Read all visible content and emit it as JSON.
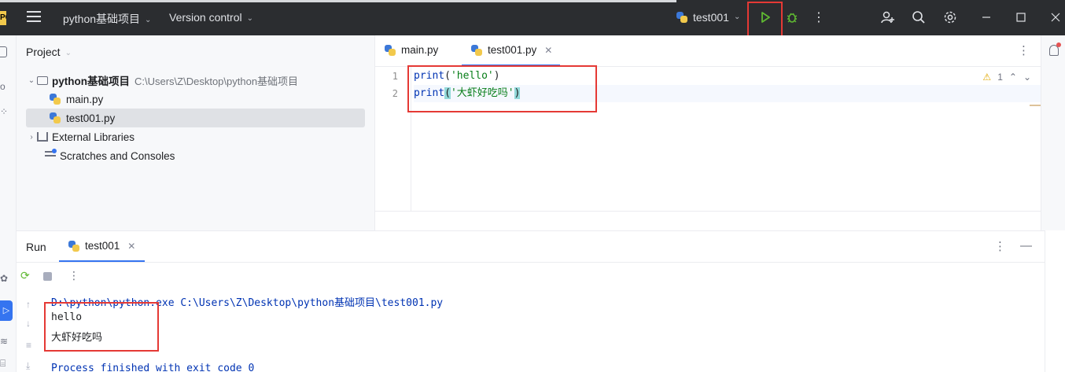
{
  "titlebar": {
    "app_logo_text": "PC",
    "project_name": "python基础项目",
    "version_control": "Version control",
    "run_config": "test001",
    "icons": [
      "hamburger-icon",
      "run-icon",
      "debug-icon",
      "more-vert-icon",
      "add-user-icon",
      "search-icon",
      "gear-icon",
      "minimize-icon",
      "maximize-icon",
      "close-icon"
    ]
  },
  "project_panel": {
    "title": "Project",
    "root_name": "python基础项目",
    "root_path": "C:\\Users\\Z\\Desktop\\python基础项目",
    "files": [
      "main.py",
      "test001.py"
    ],
    "selected_file": "test001.py",
    "external_libraries": "External Libraries",
    "scratches": "Scratches and Consoles"
  },
  "editor": {
    "tabs": [
      {
        "label": "main.py"
      },
      {
        "label": "test001.py",
        "close": "✕"
      }
    ],
    "line_numbers": [
      "1",
      "2"
    ],
    "lines": [
      {
        "fn": "print",
        "open": "(",
        "str": "'hello'",
        "close": ")"
      },
      {
        "fn": "print",
        "open": "(",
        "str": "'大虾好吃吗'",
        "close": ")"
      }
    ],
    "warning_count": "1"
  },
  "run_panel": {
    "title": "Run",
    "tab_label": "test001",
    "tab_close": "✕",
    "command": "D:\\python\\python.exe C:\\Users\\Z\\Desktop\\python基础项目\\test001.py",
    "output": [
      "hello",
      "大虾好吃吗"
    ],
    "exit_message": "Process finished with exit code 0"
  },
  "colors": {
    "accent": "#3574f0",
    "highlight_box": "#e53935",
    "run_green": "#5fb832"
  }
}
